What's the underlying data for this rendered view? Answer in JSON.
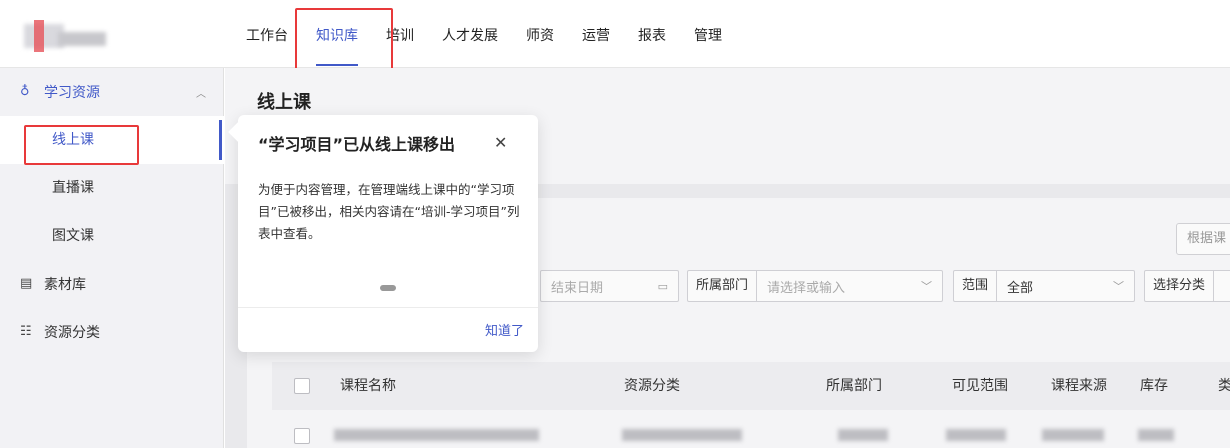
{
  "nav": {
    "items": [
      "工作台",
      "知识库",
      "培训",
      "人才发展",
      "师资",
      "运营",
      "报表",
      "管理"
    ],
    "active_index": 1
  },
  "sidebar": {
    "group1": {
      "label": "学习资源",
      "icon": "bag-icon"
    },
    "subitems": [
      "线上课",
      "直播课",
      "图文课"
    ],
    "group2": {
      "label": "素材库",
      "icon": "archive-icon"
    },
    "group3": {
      "label": "资源分类",
      "icon": "category-icon"
    }
  },
  "main": {
    "title": "线上课",
    "right_button": "根据课",
    "filters": {
      "end_date_placeholder": "结束日期",
      "dept_label": "所属部门",
      "dept_placeholder": "请选择或输入",
      "scope_label": "范围",
      "scope_value": "全部",
      "category_label": "选择分类"
    },
    "table_headers": [
      "课程名称",
      "资源分类",
      "所属部门",
      "可见范围",
      "课程来源",
      "库存",
      "类"
    ]
  },
  "popover": {
    "title": "“学习项目”已从线上课移出",
    "body": "为便于内容管理，在管理端线上课中的“学习项目”已被移出，相关内容请在“培训-学习项目”列表中查看。",
    "ok_label": "知道了"
  },
  "colors": {
    "accent": "#4159c8",
    "highlight": "#e8393a"
  }
}
